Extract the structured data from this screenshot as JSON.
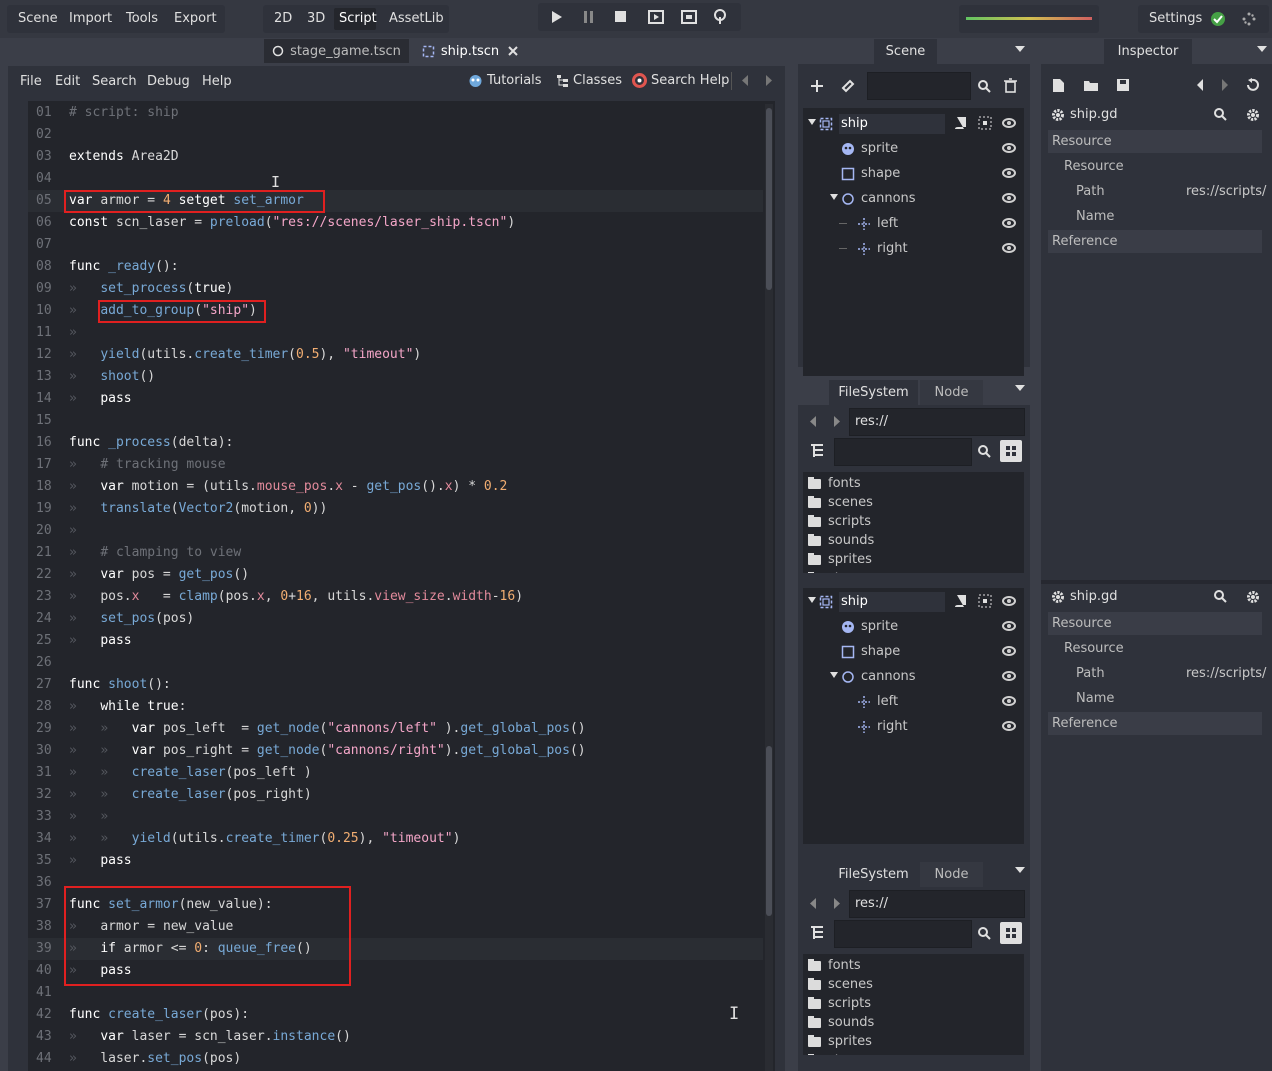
{
  "top_menu": [
    "Scene",
    "Import",
    "Tools",
    "Export"
  ],
  "workspaces": [
    "2D",
    "3D",
    "Script",
    "AssetLib"
  ],
  "active_workspace": "Script",
  "settings_label": "Settings",
  "play_controls": [
    "play-icon",
    "pause-icon",
    "stop-icon",
    "play-scene-icon",
    "play-custom-icon",
    "remote-debug-icon"
  ],
  "scene_tabs": [
    {
      "label": "stage_game.tscn",
      "icon": "circle-node-icon"
    },
    {
      "label": "ship.tscn",
      "icon": "area2d-icon",
      "active": true
    }
  ],
  "script_menu": [
    "File",
    "Edit",
    "Search",
    "Debug",
    "Help"
  ],
  "script_links": [
    "Tutorials",
    "Classes",
    "Search Help"
  ],
  "code_lines": [
    "# script: ship",
    "",
    "extends Area2D",
    "",
    "var armor = 4 setget set_armor",
    "const scn_laser = preload(\"res://scenes/laser_ship.tscn\")",
    "",
    "func _ready():",
    "»   set_process(true)",
    "»   add_to_group(\"ship\")",
    "»",
    "»   yield(utils.create_timer(0.5), \"timeout\")",
    "»   shoot()",
    "»   pass",
    "",
    "func _process(delta):",
    "»   # tracking mouse",
    "»   var motion = (utils.mouse_pos.x - get_pos().x) * 0.2",
    "»   translate(Vector2(motion, 0))",
    "»",
    "»   # clamping to view",
    "»   var pos = get_pos()",
    "»   pos.x   = clamp(pos.x, 0+16, utils.view_size.width-16)",
    "»   set_pos(pos)",
    "»   pass",
    "",
    "func shoot():",
    "»   while true:",
    "»   »   var pos_left  = get_node(\"cannons/left\" ).get_global_pos()",
    "»   »   var pos_right = get_node(\"cannons/right\").get_global_pos()",
    "»   »   create_laser(pos_left )",
    "»   »   create_laser(pos_right)",
    "»   »",
    "»   »   yield(utils.create_timer(0.25), \"timeout\")",
    "»   pass",
    "",
    "func set_armor(new_value):",
    "»   armor = new_value",
    "»   if armor <= 0: queue_free()",
    "»   pass",
    "",
    "func create_laser(pos):",
    "»   var laser = scn_laser.instance()",
    "»   laser.set_pos(pos)"
  ],
  "line_numbers": [
    "01",
    "02",
    "03",
    "04",
    "05",
    "06",
    "07",
    "08",
    "09",
    "10",
    "11",
    "12",
    "13",
    "14",
    "15",
    "16",
    "17",
    "18",
    "19",
    "20",
    "21",
    "22",
    "23",
    "24",
    "25",
    "26",
    "27",
    "28",
    "29",
    "30",
    "31",
    "32",
    "33",
    "34",
    "35",
    "36",
    "37",
    "38",
    "39",
    "40",
    "41",
    "42",
    "43",
    "44"
  ],
  "scene_panel": {
    "tab": "Scene",
    "tree": [
      {
        "label": "ship",
        "icon": "area2d-icon",
        "depth": 0
      },
      {
        "label": "sprite",
        "icon": "sprite-icon",
        "depth": 1
      },
      {
        "label": "shape",
        "icon": "shape-icon",
        "depth": 1
      },
      {
        "label": "cannons",
        "icon": "node2d-icon",
        "depth": 1
      },
      {
        "label": "left",
        "icon": "position2d-icon",
        "depth": 2
      },
      {
        "label": "right",
        "icon": "position2d-icon",
        "depth": 2
      }
    ]
  },
  "filesystem": {
    "tabs": [
      "FileSystem",
      "Node"
    ],
    "path": "res://",
    "folders": [
      "fonts",
      "scenes",
      "scripts",
      "sounds",
      "sprites",
      "stages"
    ]
  },
  "inspector": {
    "tab": "Inspector",
    "object": "ship.gd",
    "sections": [
      {
        "label": "Resource",
        "type": "header"
      },
      {
        "label": "Resource",
        "type": "sub"
      },
      {
        "label": "Path",
        "value": "res://scripts/",
        "type": "prop"
      },
      {
        "label": "Name",
        "value": "",
        "type": "prop"
      },
      {
        "label": "Reference",
        "type": "header"
      }
    ]
  },
  "colors": {
    "keyword": "#ffffff",
    "function": "#78a9d6",
    "string": "#f4a6c8",
    "number": "#f2ae72",
    "comment": "#6e7178",
    "member": "#e28a9b",
    "highlight_box": "#e02020"
  }
}
